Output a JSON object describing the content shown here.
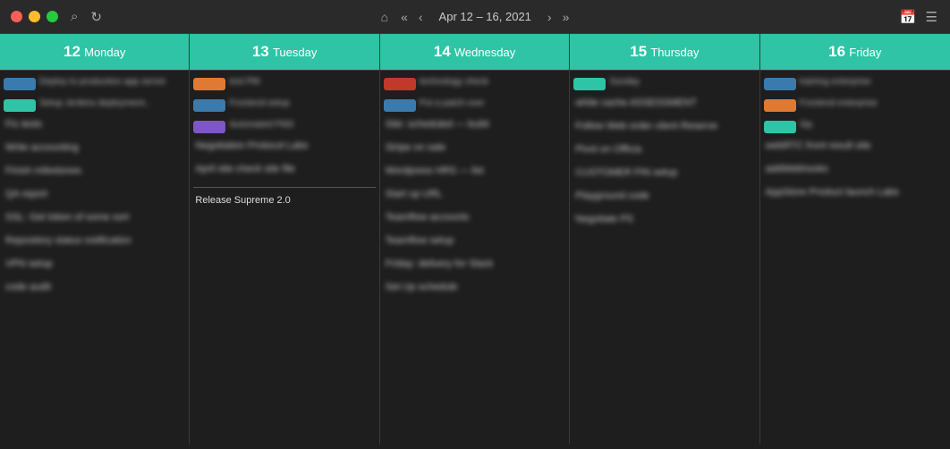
{
  "titlebar": {
    "date_range": "Apr 12 – 16, 2021",
    "home_icon": "⌂",
    "search_icon": "⌕",
    "refresh_icon": "↻",
    "prev_prev": "«",
    "prev": "‹",
    "next": "›",
    "next_next": "»",
    "calendar_icon": "📅",
    "list_icon": "☰"
  },
  "days": [
    {
      "num": "12",
      "name": "Monday"
    },
    {
      "num": "13",
      "name": "Tuesday"
    },
    {
      "num": "14",
      "name": "Wednesday"
    },
    {
      "num": "15",
      "name": "Thursday"
    },
    {
      "num": "16",
      "name": "Friday"
    }
  ],
  "special_event": {
    "label": "Release Supreme 2.0"
  }
}
